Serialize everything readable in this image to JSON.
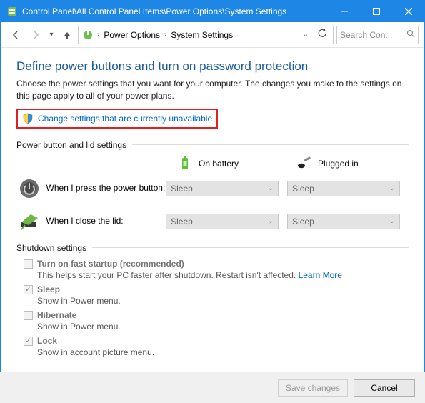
{
  "titlebar": {
    "path": "Control Panel\\All Control Panel Items\\Power Options\\System Settings"
  },
  "breadcrumb": {
    "items": [
      "Power Options",
      "System Settings"
    ]
  },
  "search": {
    "placeholder": "Search Con..."
  },
  "heading": "Define power buttons and turn on password protection",
  "description": "Choose the power settings that you want for your computer. The changes you make to the settings on this page apply to all of your power plans.",
  "change_link": "Change settings that are currently unavailable",
  "group_power": "Power button and lid settings",
  "col_battery": "On battery",
  "col_plugged": "Plugged in",
  "row_power_button": "When I press the power button:",
  "row_lid": "When I close the lid:",
  "combo_value": "Sleep",
  "group_shutdown": "Shutdown settings",
  "shutdown": {
    "fast_startup": {
      "label": "Turn on fast startup (recommended)",
      "sub": "This helps start your PC faster after shutdown. Restart isn't affected. ",
      "learn": "Learn More"
    },
    "sleep": {
      "label": "Sleep",
      "sub": "Show in Power menu."
    },
    "hibernate": {
      "label": "Hibernate",
      "sub": "Show in Power menu."
    },
    "lock": {
      "label": "Lock",
      "sub": "Show in account picture menu."
    }
  },
  "buttons": {
    "save": "Save changes",
    "cancel": "Cancel"
  }
}
